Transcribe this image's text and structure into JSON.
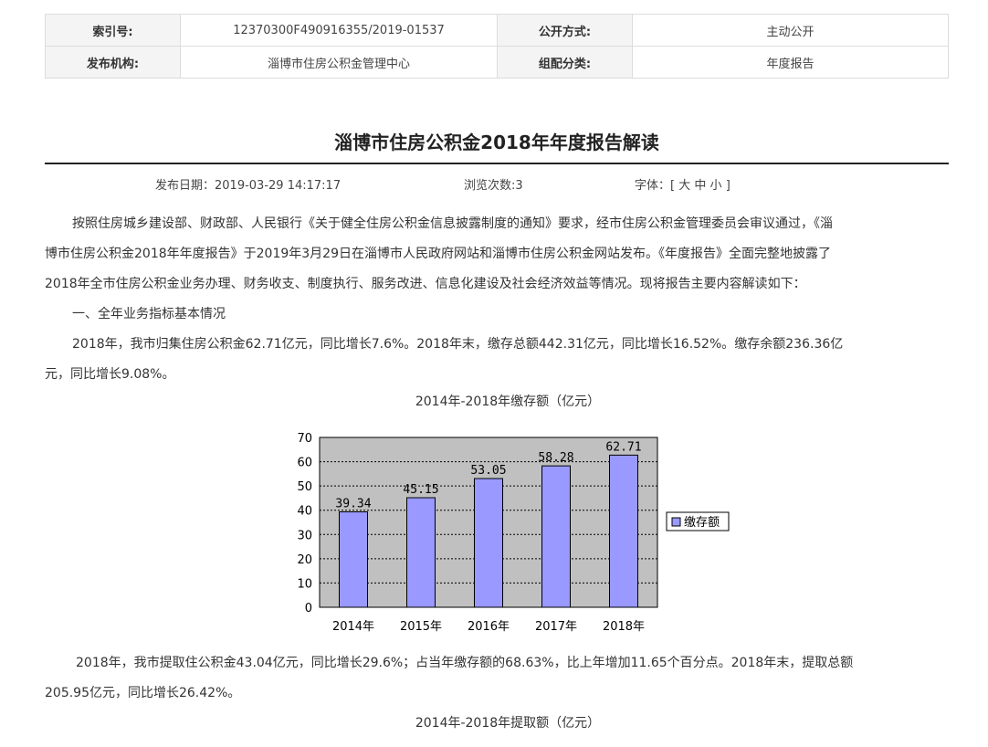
{
  "meta": {
    "index_label": "索引号:",
    "index_value": "12370300F490916355/2019-01537",
    "disclosure_label": "公开方式:",
    "disclosure_value": "主动公开",
    "publisher_label": "发布机构:",
    "publisher_value": "淄博市住房公积金管理中心",
    "category_label": "组配分类:",
    "category_value": "年度报告"
  },
  "article": {
    "title": "淄博市住房公积金2018年年度报告解读",
    "publish_label": "发布日期：",
    "publish_date": "2019-03-29 14:17:17",
    "views_label": "浏览次数:",
    "views": "3",
    "font_label": "字体：[",
    "font_large": "大",
    "font_medium": "中",
    "font_small": "小",
    "font_close": "]",
    "p1_line1": "按照住房城乡建设部、财政部、人民银行《关于健全住房公积金信息披露制度的通知》要求，经市住房公积金管理委员会审议通过，《淄",
    "p1_line2": "博市住房公积金2018年年度报告》于2019年3月29日在淄博市人民政府网站和淄博市住房公积金网站发布。《年度报告》全面完整地披露了",
    "p1_line3": "2018年全市住房公积金业务办理、财务收支、制度执行、服务改进、信息化建设及社会经济效益等情况。现将报告主要内容解读如下：",
    "section1": "一、全年业务指标基本情况",
    "p2_line1": "2018年，我市归集住房公积金62.71亿元，同比增长7.6%。2018年末，缴存总额442.31亿元，同比增长16.52%。缴存余额236.36亿",
    "p2_line2": "元，同比增长9.08%。",
    "chart1_caption": "2014年-2018年缴存额（亿元）",
    "p3_line1": "2018年，我市提取住公积金43.04亿元，同比增长29.6%；占当年缴存额的68.63%，比上年增加11.65个百分点。2018年末，提取总额",
    "p3_line2": "205.95亿元，同比增长26.42%。",
    "chart2_caption": "2014年-2018年提取额（亿元）"
  },
  "chart_data": {
    "type": "bar",
    "categories": [
      "2014年",
      "2015年",
      "2016年",
      "2017年",
      "2018年"
    ],
    "series": [
      {
        "name": "缴存额",
        "values": [
          39.34,
          45.15,
          53.05,
          58.28,
          62.71
        ]
      }
    ],
    "value_labels": [
      "39.34",
      "45.15",
      "53.05",
      "58.28",
      "62.71"
    ],
    "yticks": [
      "0",
      "10",
      "20",
      "30",
      "40",
      "50",
      "60",
      "70"
    ],
    "ylim": [
      0,
      70
    ],
    "grid": true,
    "legend": "right",
    "colors": {
      "bar": "#9999ff",
      "plot_bg": "#c0c0c0",
      "border": "#000000"
    }
  }
}
